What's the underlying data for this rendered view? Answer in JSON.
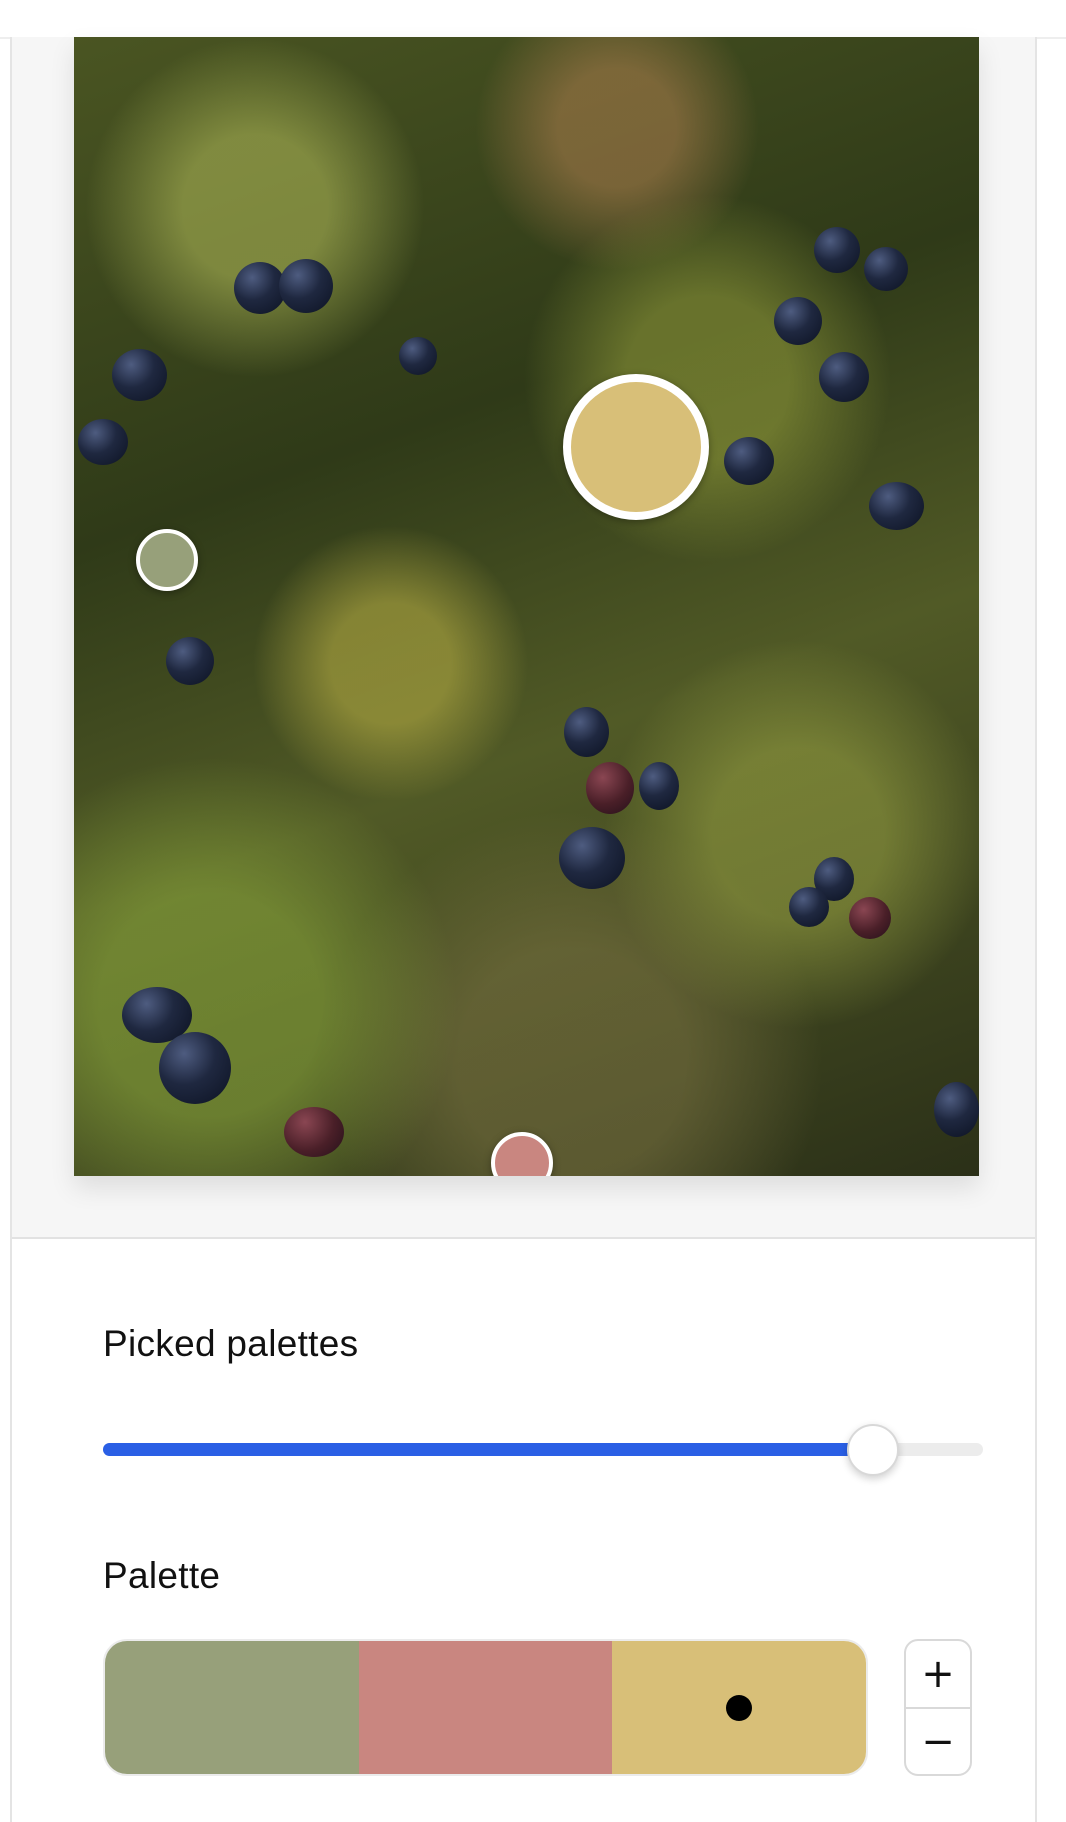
{
  "sections": {
    "picked_palettes_title": "Picked palettes",
    "palette_title": "Palette"
  },
  "slider": {
    "value_fraction": 0.875
  },
  "palette": {
    "swatches": [
      {
        "name": "sage-green",
        "color": "#97a07a",
        "selected": false
      },
      {
        "name": "dusty-rose",
        "color": "#c98680",
        "selected": false
      },
      {
        "name": "wheat",
        "color": "#d8bf78",
        "selected": true
      }
    ]
  },
  "stepper": {
    "increment_symbol": "+",
    "decrement_symbol": "−"
  },
  "accent_color": "#2a5fe5",
  "photo": {
    "description_icon": "berry-heath-photo"
  }
}
